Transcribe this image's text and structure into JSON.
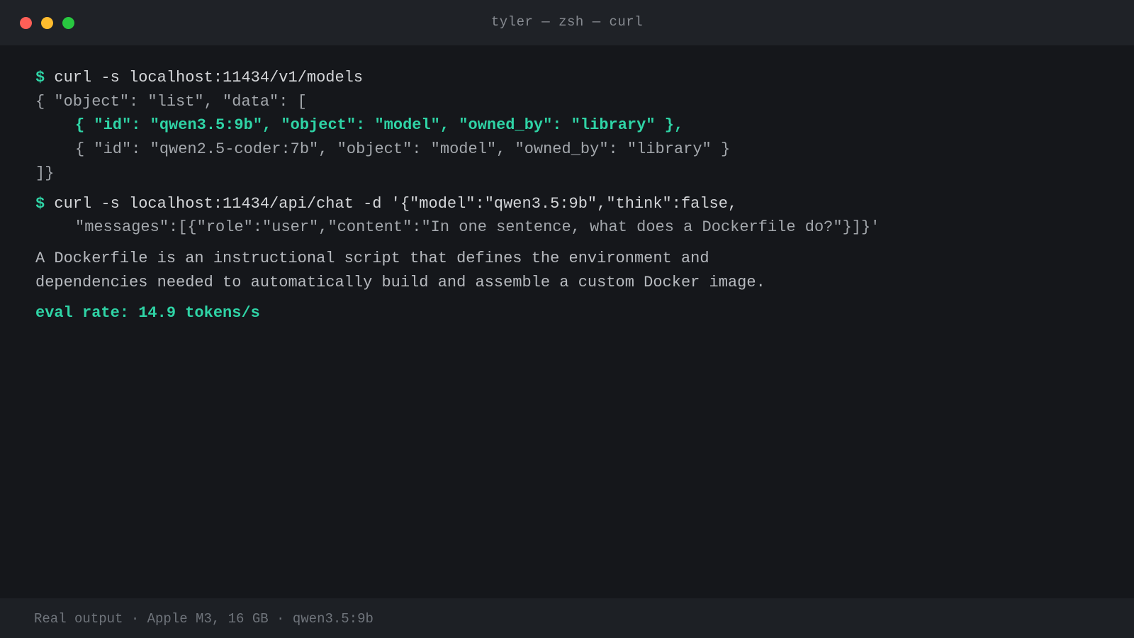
{
  "window": {
    "title": "tyler — zsh — curl"
  },
  "terminal": {
    "prompt_symbol": "$",
    "cmd1": "curl -s localhost:11434/v1/models",
    "out1_line1": "{ \"object\": \"list\", \"data\": [",
    "out1_line2": "{ \"id\": \"qwen3.5:9b\", \"object\": \"model\", \"owned_by\": \"library\" },",
    "out1_line3": "{ \"id\": \"qwen2.5-coder:7b\", \"object\": \"model\", \"owned_by\": \"library\" }",
    "out1_line4": "]}",
    "cmd2_line1": "curl -s localhost:11434/api/chat -d '{\"model\":\"qwen3.5:9b\",\"think\":false,",
    "cmd2_line2": "\"messages\":[{\"role\":\"user\",\"content\":\"In one sentence, what does a Dockerfile do?\"}]}'",
    "response_line1": "A Dockerfile is an instructional script that defines the environment and",
    "response_line2": "dependencies needed to automatically build and assemble a custom Docker image.",
    "eval_rate": "eval rate: 14.9 tokens/s"
  },
  "footer": {
    "text": "Real output · Apple M3, 16 GB · qwen3.5:9b"
  },
  "colors": {
    "accent": "#2fd4a6",
    "close": "#fe5f57",
    "minimize": "#febc2e",
    "maximize": "#28c840"
  }
}
